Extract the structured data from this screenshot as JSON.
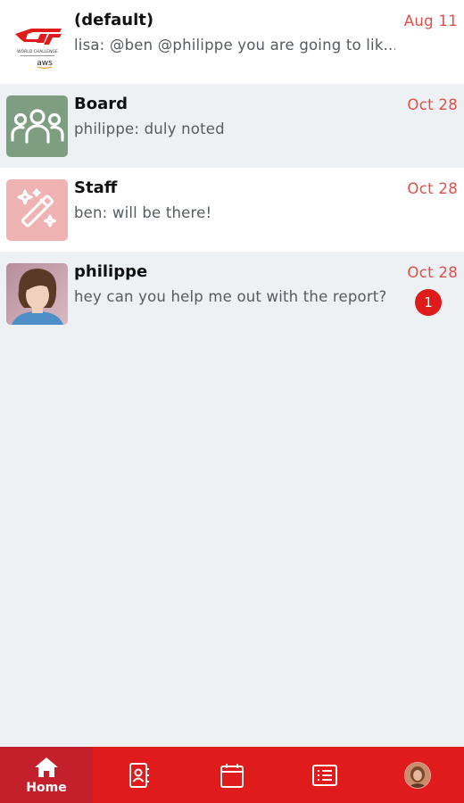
{
  "conversations": [
    {
      "title": "(default)",
      "preview": "lisa: @ben @philippe you are going to lik...",
      "date": "Aug 11",
      "avatar_icon": "event-logo",
      "logo_text": "GT",
      "logo_sub": "WORLD CHALLENGE",
      "logo_aws": "aws",
      "unread": null
    },
    {
      "title": "Board",
      "preview": "philippe: duly noted",
      "date": "Oct 28",
      "avatar_icon": "group-icon",
      "unread": null
    },
    {
      "title": "Staff",
      "preview": "ben: will be there!",
      "date": "Oct 28",
      "avatar_icon": "magic-wand-icon",
      "unread": null
    },
    {
      "title": "philippe",
      "preview": "hey can you help me out with the report?",
      "date": "Oct 28",
      "avatar_icon": "user-photo",
      "unread": "1"
    }
  ],
  "tabbar": {
    "tabs": [
      {
        "icon": "home-icon",
        "label": "Home",
        "active": true
      },
      {
        "icon": "contacts-icon",
        "label": "",
        "active": false
      },
      {
        "icon": "calendar-icon",
        "label": "",
        "active": false
      },
      {
        "icon": "list-icon",
        "label": "",
        "active": false
      },
      {
        "icon": "profile-avatar",
        "label": "",
        "active": false
      }
    ]
  },
  "colors": {
    "accent": "#e01b1b",
    "active_tab": "#c4202b",
    "date": "#e0504a",
    "list_bg": "#eef1f4"
  }
}
